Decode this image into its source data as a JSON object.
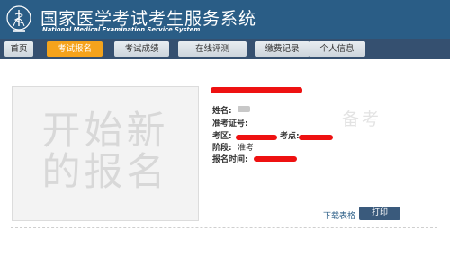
{
  "header": {
    "title_cn": "国家医学考试考生服务系统",
    "title_en": "National Medical Examination Service System"
  },
  "nav": {
    "items": [
      {
        "label": "首页",
        "active": false
      },
      {
        "label": "考试报名",
        "active": true
      },
      {
        "label": "考试成绩",
        "active": false
      },
      {
        "label": "在线评测",
        "active": false
      },
      {
        "label": "缴费记录",
        "active": false
      },
      {
        "label": "个人信息",
        "active": false
      }
    ]
  },
  "card": {
    "photo_placeholder_line1": "开始新",
    "photo_placeholder_line2": "的报名",
    "fields": {
      "name_label": "姓名:",
      "ticket_label": "准考证号:",
      "district_label": "考区:",
      "site_label": "考点:",
      "stage_label": "阶段:",
      "stage_value": "准考",
      "time_label": "报名时间:"
    },
    "watermark": "备考",
    "download_label": "下载表格",
    "print_label": "打印"
  },
  "colors": {
    "header_bg": "#2a5d86",
    "nav_bg": "#355070",
    "active_tab": "#f5a31c",
    "redaction": "#ee1111"
  }
}
